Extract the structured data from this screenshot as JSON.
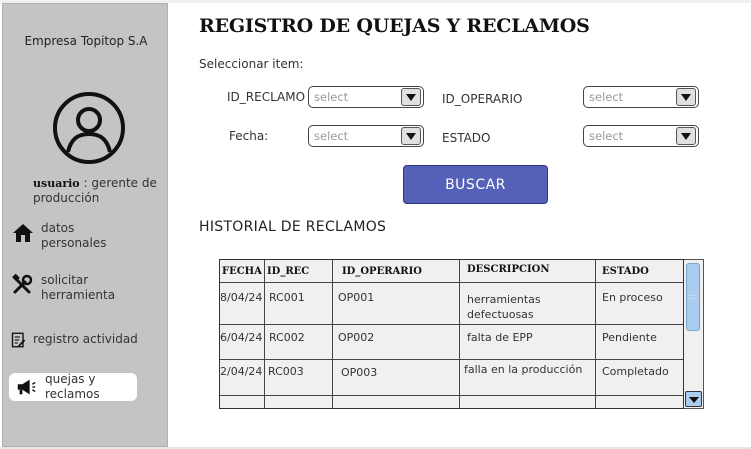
{
  "sidebar": {
    "company": "Empresa Topitop S.A",
    "user_label": "usuario",
    "user_role": " : gerente de producción",
    "items": [
      {
        "label": "datos personales",
        "icon": "home-icon"
      },
      {
        "label": "solicitar herramienta",
        "icon": "tools-icon"
      },
      {
        "label": "registro actividad",
        "icon": "clipboard-edit-icon"
      },
      {
        "label": "quejas y reclamos",
        "icon": "megaphone-icon",
        "active": true
      }
    ]
  },
  "main": {
    "title": "REGISTRO DE QUEJAS Y RECLAMOS",
    "select_item_label": "Seleccionar item:",
    "filters": {
      "id_reclamo": {
        "label": "ID_RECLAMO",
        "placeholder": "select"
      },
      "id_operario": {
        "label": "ID_OPERARIO",
        "placeholder": "select"
      },
      "fecha": {
        "label": "Fecha:",
        "placeholder": "select"
      },
      "estado": {
        "label": "ESTADO",
        "placeholder": "select"
      }
    },
    "search_button": "BUSCAR",
    "history_title": "HISTORIAL DE RECLAMOS"
  },
  "table": {
    "headers": [
      "FECHA",
      "ID_REC",
      "ID_OPERARIO",
      "DESCRIPCION",
      "ESTADO"
    ],
    "rows": [
      [
        "8/04/24",
        "RC001",
        "OP001",
        "herramientas defectuosas",
        "En proceso"
      ],
      [
        "6/04/24",
        "RC002",
        "OP002",
        "falta de EPP",
        "Pendiente"
      ],
      [
        "2/04/24",
        "RC003",
        "OP003",
        "falla en la producción",
        "Completado"
      ]
    ]
  },
  "colors": {
    "sidebar_bg": "#c4c4c4",
    "button_bg": "#5560b8",
    "scroll_accent": "#aaccee"
  }
}
